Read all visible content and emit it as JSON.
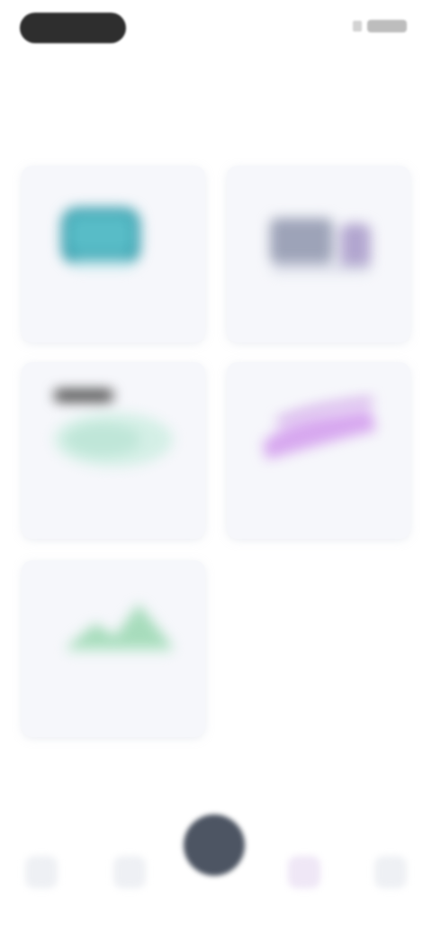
{
  "status_bar": {
    "time": "",
    "icons": [
      "signal-icon",
      "battery-icon"
    ]
  },
  "section": {
    "title": ""
  },
  "cards": [
    {
      "label": "",
      "icon": "device-illustration-icon",
      "accent": "#3fa3b0"
    },
    {
      "label": "",
      "icon": "monitor-illustration-icon",
      "accent": "#9aa0b8"
    },
    {
      "label": "",
      "icon": "cloud-illustration-icon",
      "accent": "#9fd7c4"
    },
    {
      "label": "",
      "icon": "wave-illustration-icon",
      "accent": "#c88be3"
    },
    {
      "label": "",
      "icon": "mountain-illustration-icon",
      "accent": "#8fd1a8"
    }
  ],
  "bottom_nav": {
    "items": [
      {
        "label": "",
        "icon": "home-icon"
      },
      {
        "label": "",
        "icon": "grid-icon"
      },
      {
        "label": "",
        "icon": "center-action-icon"
      },
      {
        "label": "",
        "icon": "star-icon"
      },
      {
        "label": "",
        "icon": "profile-icon"
      }
    ]
  },
  "colors": {
    "background": "#ffffff",
    "card_bg": "#f6f7fb",
    "fab": "#4d5563",
    "active_nav": "#efe7f6"
  }
}
